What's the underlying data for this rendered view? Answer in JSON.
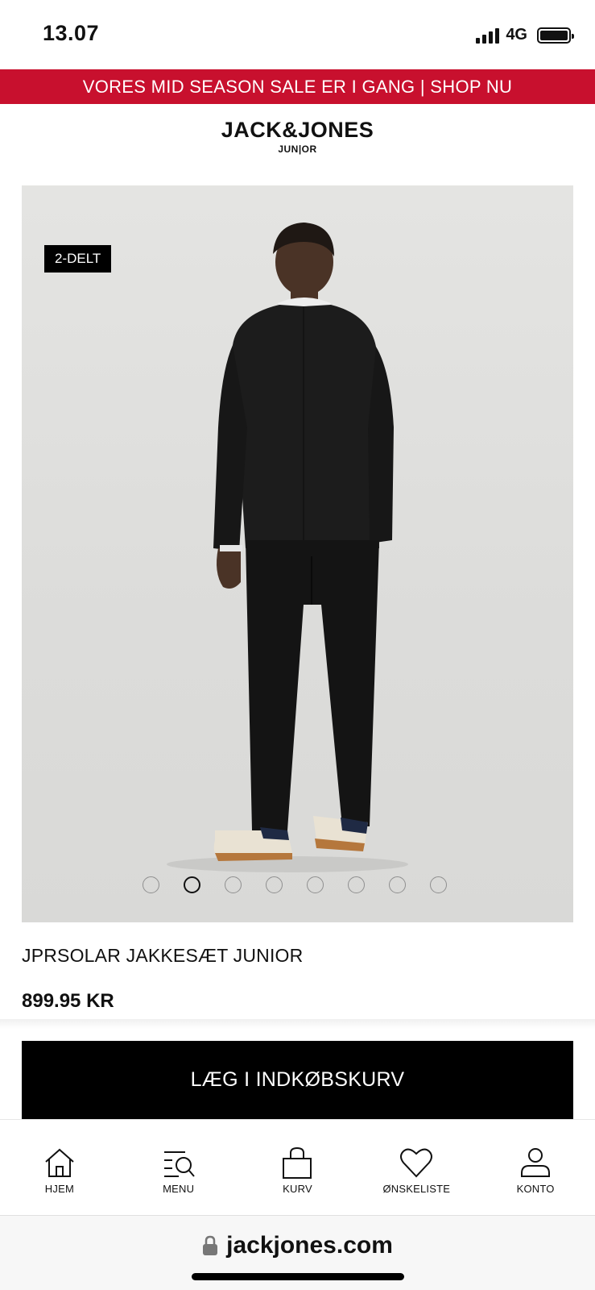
{
  "status_bar": {
    "time": "13.07",
    "network": "4G"
  },
  "promo_banner": {
    "text": "VORES MID SEASON SALE ER I GANG | SHOP NU"
  },
  "brand": {
    "name": "JACK&JONES",
    "sub": "JUN|OR"
  },
  "product": {
    "badge": "2-DELT",
    "name": "JPRSOLAR JAKKESÆT JUNIOR",
    "price": "899.95 KR",
    "image_count": 8,
    "active_image_index": 1
  },
  "add_to_cart": {
    "label": "LÆG I INDKØBSKURV"
  },
  "bottom_nav": {
    "items": [
      {
        "label": "HJEM",
        "icon": "home-icon"
      },
      {
        "label": "MENU",
        "icon": "menu-search-icon"
      },
      {
        "label": "KURV",
        "icon": "bag-icon"
      },
      {
        "label": "ØNSKELISTE",
        "icon": "heart-icon"
      },
      {
        "label": "KONTO",
        "icon": "user-icon"
      }
    ]
  },
  "browser": {
    "url": "jackjones.com"
  },
  "colors": {
    "promo_red": "#c8102e",
    "button_black": "#000000",
    "image_bg": "#e0e0de"
  }
}
